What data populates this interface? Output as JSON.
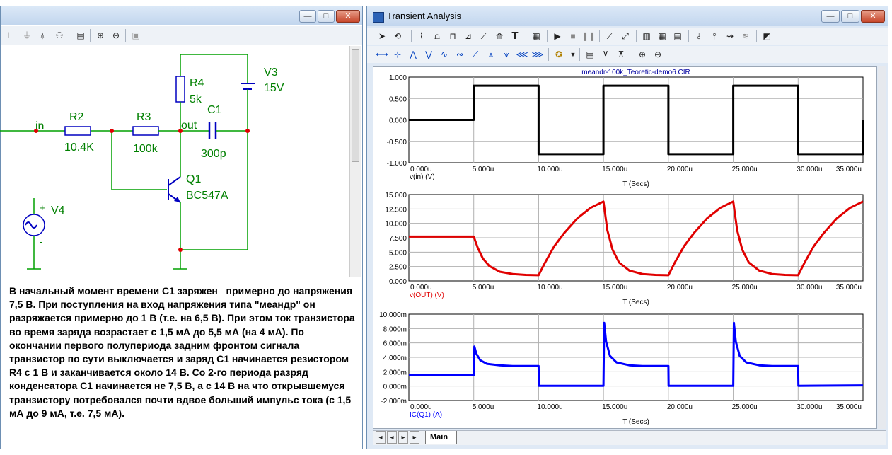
{
  "schematic": {
    "labels": {
      "in": "in",
      "out": "out",
      "r2_name": "R2",
      "r2_value": "10.4K",
      "r3_name": "R3",
      "r3_value": "100k",
      "r4_name": "R4",
      "r4_value": "5k",
      "c1_name": "C1",
      "c1_value": "300p",
      "v3_name": "V3",
      "v3_value": "15V",
      "q1_name": "Q1",
      "q1_model": "BC547A",
      "v4_name": "V4",
      "v4_plus": "+",
      "v4_minus": "-"
    },
    "description": "В начальный момент времени С1 заряжен   примерно до напряжения 7,5 В. При поступления на вход напряжения типа \"меандр\" он   разряжается примерно до 1 В (т.е. на 6,5 В). При этом ток транзистора во время заряда возрастает с 1,5 мА до 5,5 мА (на 4 мА). По окончании первого полупериода задним фронтом сигнала транзистор по сути выключается и заряд С1 начинается резистором R4 с 1 В и заканчивается около 14 В. Со 2-го периода разряд конденсатора С1 начинается не 7,5 В, а с 14 В на что открывшемуся транзистору потребовался почти вдвое больший импульс тока (с 1,5 мА до 9 мА, т.е. 7,5 мА)."
  },
  "window": {
    "title": "Transient Analysis",
    "buttons": {
      "minimize": "—",
      "maximize": "□",
      "close": "✕"
    }
  },
  "tabs": {
    "nav": [
      "◂",
      "◂",
      "▸",
      "▸"
    ],
    "active": "Main"
  },
  "chart_data": [
    {
      "type": "line",
      "title": "meandr-100k_Teoretic-demo6.CIR",
      "xlabel": "T (Secs)",
      "ylabel": "v(in) (V)",
      "xlim": [
        0,
        35
      ],
      "ylim": [
        -1,
        1
      ],
      "xticks": [
        "0.000u",
        "5.000u",
        "10.000u",
        "15.000u",
        "20.000u",
        "25.000u",
        "30.000u",
        "35.000u"
      ],
      "yticks": [
        "1.000",
        "0.500",
        "0.000",
        "-0.500",
        "-1.000"
      ],
      "grid": true,
      "color": "#000000",
      "series": [
        {
          "x": [
            0,
            5,
            5,
            10,
            10,
            15,
            15,
            20,
            20,
            25,
            25,
            30,
            30,
            35,
            35
          ],
          "y": [
            0,
            0,
            0.8,
            0.8,
            -0.8,
            -0.8,
            0.8,
            0.8,
            -0.8,
            -0.8,
            0.8,
            0.8,
            -0.8,
            -0.8,
            0
          ]
        }
      ]
    },
    {
      "type": "line",
      "title": "",
      "xlabel": "T (Secs)",
      "ylabel": "v(OUT) (V)",
      "xlim": [
        0,
        35
      ],
      "ylim": [
        0,
        15
      ],
      "xticks": [
        "0.000u",
        "5.000u",
        "10.000u",
        "15.000u",
        "20.000u",
        "25.000u",
        "30.000u",
        "35.000u"
      ],
      "yticks": [
        "15.000",
        "12.500",
        "10.000",
        "7.500",
        "5.000",
        "2.500",
        "0.000"
      ],
      "grid": true,
      "color": "#e00000",
      "series": [
        {
          "x": [
            0,
            5,
            5.3,
            5.7,
            6.2,
            7,
            8,
            9,
            10,
            10.5,
            11.2,
            12,
            13,
            14,
            15,
            15.3,
            15.7,
            16.2,
            17,
            18,
            19,
            20,
            20.5,
            21.2,
            22,
            23,
            24,
            25,
            25.3,
            25.7,
            26.2,
            27,
            28,
            29,
            30,
            30.5,
            31.2,
            32,
            33,
            34,
            35
          ],
          "y": [
            7.7,
            7.7,
            5.8,
            3.9,
            2.6,
            1.6,
            1.2,
            1.05,
            1.0,
            3.2,
            6.0,
            8.4,
            10.9,
            12.7,
            13.8,
            8.8,
            5.4,
            3.2,
            1.8,
            1.2,
            1.05,
            1.0,
            3.2,
            6.0,
            8.4,
            10.9,
            12.7,
            13.8,
            8.8,
            5.4,
            3.2,
            1.8,
            1.2,
            1.05,
            1.0,
            3.2,
            6.0,
            8.4,
            10.9,
            12.7,
            13.8
          ]
        }
      ]
    },
    {
      "type": "line",
      "title": "",
      "xlabel": "T (Secs)",
      "ylabel": "IC(Q1) (A)",
      "xlim": [
        0,
        35
      ],
      "ylim": [
        -2,
        10
      ],
      "xticks": [
        "0.000u",
        "5.000u",
        "10.000u",
        "15.000u",
        "20.000u",
        "25.000u",
        "30.000u",
        "35.000u"
      ],
      "yticks": [
        "10.000m",
        "8.000m",
        "6.000m",
        "4.000m",
        "2.000m",
        "0.000m",
        "-2.000m"
      ],
      "grid": true,
      "color": "#0000ff",
      "series": [
        {
          "x": [
            0,
            5,
            5.05,
            5.2,
            5.5,
            6,
            7,
            8,
            10,
            10.02,
            15,
            15.05,
            15.2,
            15.5,
            16,
            17,
            18,
            20,
            20.02,
            25,
            25.05,
            25.2,
            25.5,
            26,
            27,
            28,
            30,
            30.02,
            35
          ],
          "y": [
            1.5,
            1.5,
            5.5,
            4.5,
            3.6,
            3.1,
            2.9,
            2.8,
            2.8,
            0.05,
            0.05,
            8.8,
            6.2,
            4.2,
            3.3,
            2.9,
            2.8,
            2.8,
            0.05,
            0.05,
            8.8,
            6.2,
            4.2,
            3.3,
            2.9,
            2.8,
            2.8,
            0.05,
            0.1
          ]
        }
      ]
    }
  ]
}
